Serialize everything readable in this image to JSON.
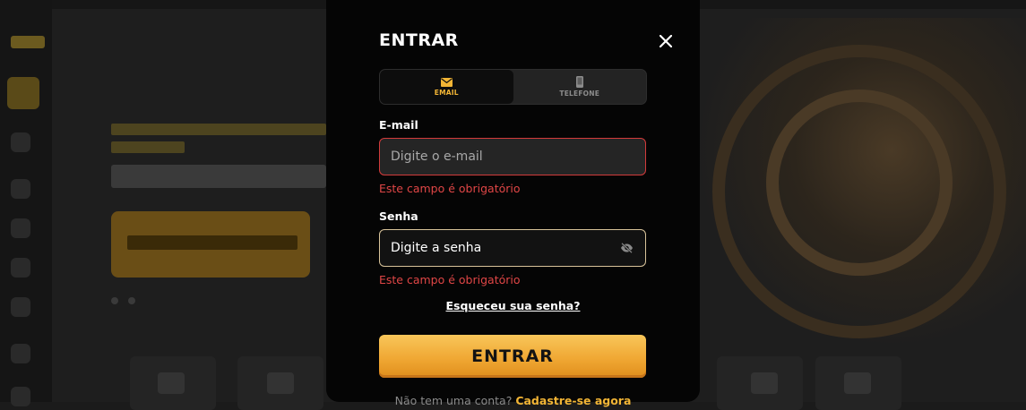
{
  "modal": {
    "title": "ENTRAR",
    "close_icon": "close-icon",
    "tabs": [
      {
        "label": "EMAIL",
        "icon": "envelope-icon",
        "active": true
      },
      {
        "label": "TELEFONE",
        "icon": "phone-icon",
        "active": false
      }
    ],
    "email": {
      "label": "E-mail",
      "placeholder": "Digite o e-mail",
      "value": "",
      "error": "Este campo é obrigatório"
    },
    "password": {
      "label": "Senha",
      "placeholder": "Digite a senha",
      "value": "",
      "error": "Este campo é obrigatório",
      "toggle_icon": "eye-off-icon"
    },
    "forgot_link": "Esqueceu sua senha?",
    "submit_label": "ENTRAR",
    "footer_text": "Não tem uma conta?",
    "footer_link": "Cadastre-se agora"
  },
  "colors": {
    "accent": "#f2b535",
    "error": "#e04646",
    "modal_bg": "#050505",
    "input_bg": "#252525"
  }
}
